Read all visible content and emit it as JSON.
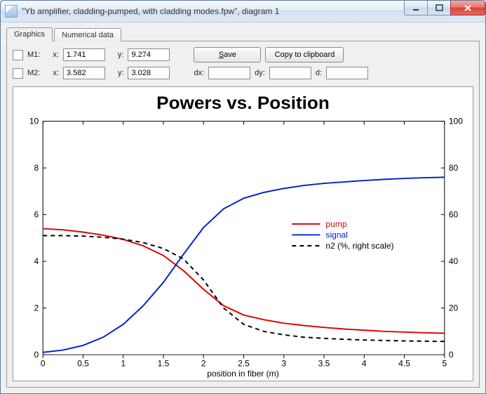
{
  "window": {
    "title": "\"Yb amplifier, cladding-pumped, with cladding modes.fpw\", diagram 1"
  },
  "tabs": {
    "graphics": "Graphics",
    "numerical": "Numerical data"
  },
  "toolbar": {
    "m1_label": "M1:",
    "m2_label": "M2:",
    "x_label": "x:",
    "y_label": "y:",
    "dx_label": "dx:",
    "dy_label": "dy:",
    "d_label": "d:",
    "m1_x": "1.741",
    "m1_y": "9.274",
    "m2_x": "3.582",
    "m2_y": "3.028",
    "dx": "",
    "dy": "",
    "d": "",
    "save_button_prefix": "",
    "save_button_u": "S",
    "save_button_rest": "ave",
    "copy_button": "Copy to clipboard"
  },
  "chart_data": {
    "type": "line",
    "title": "Powers vs. Position",
    "xlabel": "position in fiber (m)",
    "ylabel_left": "",
    "ylabel_right": "",
    "xlim": [
      0,
      5
    ],
    "ylim_left": [
      0,
      10
    ],
    "ylim_right": [
      0,
      100
    ],
    "x_ticks": [
      0,
      0.5,
      1,
      1.5,
      2,
      2.5,
      3,
      3.5,
      4,
      4.5,
      5
    ],
    "y_ticks_left": [
      0,
      2,
      4,
      6,
      8,
      10
    ],
    "y_ticks_right": [
      0,
      20,
      40,
      60,
      80,
      100
    ],
    "legend": {
      "pump": "pump",
      "signal": "signal",
      "n2": "n2 (%, right scale)"
    },
    "series": [
      {
        "name": "pump",
        "color": "#e00000",
        "dash": "none",
        "yaxis": "left",
        "x": [
          0.0,
          0.25,
          0.5,
          0.75,
          1.0,
          1.25,
          1.5,
          1.75,
          2.0,
          2.25,
          2.5,
          2.75,
          3.0,
          3.25,
          3.5,
          3.75,
          4.0,
          4.25,
          4.5,
          4.75,
          5.0
        ],
        "y": [
          5.4,
          5.35,
          5.25,
          5.12,
          4.94,
          4.66,
          4.25,
          3.6,
          2.8,
          2.1,
          1.7,
          1.5,
          1.35,
          1.25,
          1.17,
          1.1,
          1.05,
          1.0,
          0.97,
          0.94,
          0.92
        ]
      },
      {
        "name": "signal",
        "color": "#0020d0",
        "dash": "none",
        "yaxis": "left",
        "x": [
          0.0,
          0.25,
          0.5,
          0.75,
          1.0,
          1.25,
          1.5,
          1.75,
          2.0,
          2.25,
          2.5,
          2.75,
          3.0,
          3.25,
          3.5,
          3.75,
          4.0,
          4.25,
          4.5,
          4.75,
          5.0
        ],
        "y": [
          0.1,
          0.2,
          0.4,
          0.75,
          1.3,
          2.1,
          3.1,
          4.3,
          5.45,
          6.25,
          6.7,
          6.95,
          7.12,
          7.25,
          7.34,
          7.4,
          7.46,
          7.51,
          7.55,
          7.58,
          7.6
        ]
      },
      {
        "name": "n2",
        "color": "#000000",
        "dash": "6,5",
        "yaxis": "right",
        "x": [
          0.0,
          0.25,
          0.5,
          0.75,
          1.0,
          1.25,
          1.5,
          1.75,
          2.0,
          2.25,
          2.5,
          2.75,
          3.0,
          3.25,
          3.5,
          3.75,
          4.0,
          4.25,
          4.5,
          4.75,
          5.0
        ],
        "y": [
          51.0,
          51.0,
          50.8,
          50.3,
          49.5,
          48.0,
          45.5,
          41.0,
          32.0,
          20.0,
          13.0,
          10.0,
          8.5,
          7.5,
          7.0,
          6.6,
          6.3,
          6.1,
          5.9,
          5.8,
          5.7
        ]
      }
    ]
  }
}
